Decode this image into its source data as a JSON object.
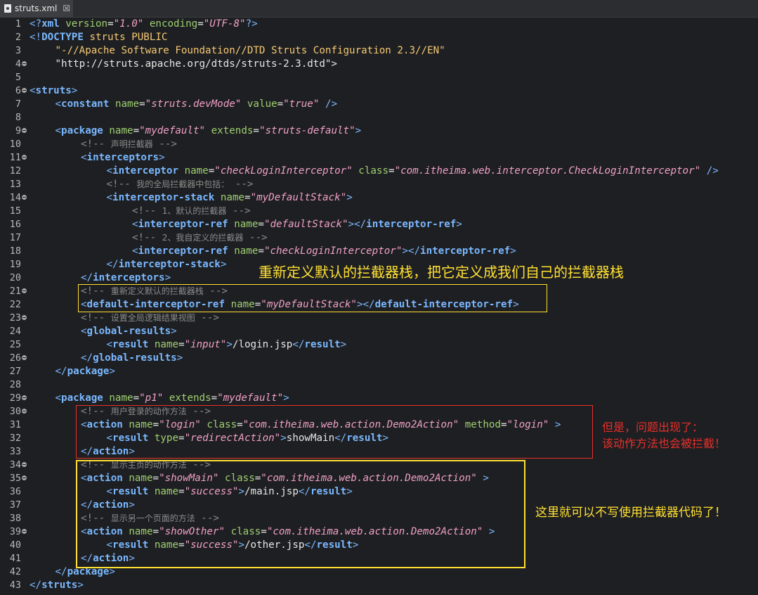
{
  "tab": {
    "filename": "struts.xml",
    "close_symbol": "☒"
  },
  "colors": {
    "tag": "#7ab8ff",
    "attr": "#9ed070",
    "value": "#f0a0c8",
    "comment": "#8c8c8c",
    "annotation_yellow": "#ffe033",
    "annotation_red": "#e8302b"
  },
  "lines": [
    {
      "n": "1",
      "fold": false,
      "indent": 0,
      "segs": [
        [
          "p",
          "<?"
        ],
        [
          "t",
          "xml"
        ],
        [
          "s",
          " "
        ],
        [
          "a",
          "version"
        ],
        [
          "s",
          "="
        ],
        [
          "v",
          "\"1.0\""
        ],
        [
          "s",
          " "
        ],
        [
          "a",
          "encoding"
        ],
        [
          "s",
          "="
        ],
        [
          "v",
          "\"UTF-8\""
        ],
        [
          "p",
          "?>"
        ]
      ]
    },
    {
      "n": "2",
      "fold": false,
      "indent": 0,
      "segs": [
        [
          "p",
          "<!"
        ],
        [
          "t",
          "DOCTYPE"
        ],
        [
          "s",
          " "
        ],
        [
          "dt",
          "struts PUBLIC"
        ]
      ]
    },
    {
      "n": "3",
      "fold": false,
      "indent": 1,
      "segs": [
        [
          "dt",
          "\"-//Apache Software Foundation//DTD Struts Configuration 2.3//EN\""
        ]
      ]
    },
    {
      "n": "4",
      "fold": true,
      "indent": 1,
      "segs": [
        [
          "s",
          "\"http://struts.apache.org/dtds/struts-2.3.dtd\">"
        ]
      ]
    },
    {
      "n": "5",
      "fold": false,
      "indent": 0,
      "segs": []
    },
    {
      "n": "6",
      "fold": true,
      "indent": 0,
      "segs": [
        [
          "p",
          "<"
        ],
        [
          "t",
          "struts"
        ],
        [
          "p",
          ">"
        ]
      ]
    },
    {
      "n": "7",
      "fold": false,
      "indent": 1,
      "segs": [
        [
          "p",
          "<"
        ],
        [
          "t",
          "constant"
        ],
        [
          "s",
          " "
        ],
        [
          "a",
          "name"
        ],
        [
          "s",
          "="
        ],
        [
          "v",
          "\"struts.devMode\""
        ],
        [
          "s",
          " "
        ],
        [
          "a",
          "value"
        ],
        [
          "s",
          "="
        ],
        [
          "v",
          "\"true\""
        ],
        [
          "s",
          " "
        ],
        [
          "p",
          "/>"
        ]
      ]
    },
    {
      "n": "8",
      "fold": false,
      "indent": 0,
      "segs": []
    },
    {
      "n": "9",
      "fold": true,
      "indent": 1,
      "segs": [
        [
          "p",
          "<"
        ],
        [
          "t",
          "package"
        ],
        [
          "s",
          " "
        ],
        [
          "a",
          "name"
        ],
        [
          "s",
          "="
        ],
        [
          "v",
          "\"mydefault\""
        ],
        [
          "s",
          " "
        ],
        [
          "a",
          "extends"
        ],
        [
          "s",
          "="
        ],
        [
          "v",
          "\"struts-default\""
        ],
        [
          "p",
          ">"
        ]
      ]
    },
    {
      "n": "10",
      "fold": false,
      "indent": 2,
      "segs": [
        [
          "c",
          "<!-- "
        ],
        [
          "cz",
          "声明拦截器"
        ],
        [
          "c",
          " -->"
        ]
      ]
    },
    {
      "n": "11",
      "fold": true,
      "indent": 2,
      "segs": [
        [
          "p",
          "<"
        ],
        [
          "t",
          "interceptors"
        ],
        [
          "p",
          ">"
        ]
      ]
    },
    {
      "n": "12",
      "fold": false,
      "indent": 3,
      "segs": [
        [
          "p",
          "<"
        ],
        [
          "t",
          "interceptor"
        ],
        [
          "s",
          " "
        ],
        [
          "a",
          "name"
        ],
        [
          "s",
          "="
        ],
        [
          "v",
          "\"checkLoginInterceptor\""
        ],
        [
          "s",
          " "
        ],
        [
          "a",
          "class"
        ],
        [
          "s",
          "="
        ],
        [
          "v",
          "\"com.itheima.web.interceptor.CheckLoginInterceptor\""
        ],
        [
          "s",
          " "
        ],
        [
          "p",
          "/>"
        ]
      ]
    },
    {
      "n": "13",
      "fold": false,
      "indent": 3,
      "segs": [
        [
          "c",
          "<!-- "
        ],
        [
          "cz",
          "我的全局拦截器中包括："
        ],
        [
          "c",
          " -->"
        ]
      ]
    },
    {
      "n": "14",
      "fold": true,
      "indent": 3,
      "segs": [
        [
          "p",
          "<"
        ],
        [
          "t",
          "interceptor-stack"
        ],
        [
          "s",
          " "
        ],
        [
          "a",
          "name"
        ],
        [
          "s",
          "="
        ],
        [
          "v",
          "\"myDefaultStack\""
        ],
        [
          "p",
          ">"
        ]
      ]
    },
    {
      "n": "15",
      "fold": false,
      "indent": 4,
      "segs": [
        [
          "c",
          "<!-- "
        ],
        [
          "cz",
          "1、默认的拦截器"
        ],
        [
          "c",
          " -->"
        ]
      ]
    },
    {
      "n": "16",
      "fold": false,
      "indent": 4,
      "segs": [
        [
          "p",
          "<"
        ],
        [
          "t",
          "interceptor-ref"
        ],
        [
          "s",
          " "
        ],
        [
          "a",
          "name"
        ],
        [
          "s",
          "="
        ],
        [
          "v",
          "\"defaultStack\""
        ],
        [
          "p",
          ">"
        ],
        [
          "p",
          "</"
        ],
        [
          "t",
          "interceptor-ref"
        ],
        [
          "p",
          ">"
        ]
      ]
    },
    {
      "n": "17",
      "fold": false,
      "indent": 4,
      "segs": [
        [
          "c",
          "<!-- "
        ],
        [
          "cz",
          "2、我自定义的拦截器"
        ],
        [
          "c",
          " -->"
        ]
      ]
    },
    {
      "n": "18",
      "fold": false,
      "indent": 4,
      "segs": [
        [
          "p",
          "<"
        ],
        [
          "t",
          "interceptor-ref"
        ],
        [
          "s",
          " "
        ],
        [
          "a",
          "name"
        ],
        [
          "s",
          "="
        ],
        [
          "v",
          "\"checkLoginInterceptor\""
        ],
        [
          "p",
          ">"
        ],
        [
          "p",
          "</"
        ],
        [
          "t",
          "interceptor-ref"
        ],
        [
          "p",
          ">"
        ]
      ]
    },
    {
      "n": "19",
      "fold": false,
      "indent": 3,
      "segs": [
        [
          "p",
          "</"
        ],
        [
          "t",
          "interceptor-stack"
        ],
        [
          "p",
          ">"
        ]
      ]
    },
    {
      "n": "20",
      "fold": false,
      "indent": 2,
      "segs": [
        [
          "p",
          "</"
        ],
        [
          "t",
          "interceptors"
        ],
        [
          "p",
          ">"
        ]
      ]
    },
    {
      "n": "21",
      "fold": true,
      "indent": 2,
      "segs": [
        [
          "c",
          "<!-- "
        ],
        [
          "cz",
          "重新定义默认的拦截器栈"
        ],
        [
          "c",
          " -->"
        ]
      ]
    },
    {
      "n": "22",
      "fold": false,
      "indent": 2,
      "segs": [
        [
          "p",
          "<"
        ],
        [
          "t",
          "default-interceptor-ref"
        ],
        [
          "s",
          " "
        ],
        [
          "a",
          "name"
        ],
        [
          "s",
          "="
        ],
        [
          "v",
          "\"myDefaultStack\""
        ],
        [
          "p",
          ">"
        ],
        [
          "p",
          "</"
        ],
        [
          "t",
          "default-interceptor-ref"
        ],
        [
          "p",
          ">"
        ]
      ]
    },
    {
      "n": "23",
      "fold": true,
      "indent": 2,
      "segs": [
        [
          "c",
          "<!-- "
        ],
        [
          "cz",
          "设置全局逻辑结果视图"
        ],
        [
          "c",
          " -->"
        ]
      ]
    },
    {
      "n": "24",
      "fold": false,
      "indent": 2,
      "segs": [
        [
          "p",
          "<"
        ],
        [
          "t",
          "global-results"
        ],
        [
          "p",
          ">"
        ]
      ]
    },
    {
      "n": "25",
      "fold": false,
      "indent": 3,
      "segs": [
        [
          "p",
          "<"
        ],
        [
          "t",
          "result"
        ],
        [
          "s",
          " "
        ],
        [
          "a",
          "name"
        ],
        [
          "s",
          "="
        ],
        [
          "v",
          "\"input\""
        ],
        [
          "p",
          ">"
        ],
        [
          "s",
          "/login.jsp"
        ],
        [
          "p",
          "</"
        ],
        [
          "t",
          "result"
        ],
        [
          "p",
          ">"
        ]
      ]
    },
    {
      "n": "26",
      "fold": true,
      "indent": 2,
      "segs": [
        [
          "p",
          "</"
        ],
        [
          "t",
          "global-results"
        ],
        [
          "p",
          ">"
        ]
      ]
    },
    {
      "n": "27",
      "fold": false,
      "indent": 1,
      "segs": [
        [
          "p",
          "</"
        ],
        [
          "t",
          "package"
        ],
        [
          "p",
          ">"
        ]
      ]
    },
    {
      "n": "28",
      "fold": false,
      "indent": 0,
      "segs": []
    },
    {
      "n": "29",
      "fold": true,
      "indent": 1,
      "segs": [
        [
          "p",
          "<"
        ],
        [
          "t",
          "package"
        ],
        [
          "s",
          " "
        ],
        [
          "a",
          "name"
        ],
        [
          "s",
          "="
        ],
        [
          "v",
          "\"p1\""
        ],
        [
          "s",
          " "
        ],
        [
          "a",
          "extends"
        ],
        [
          "s",
          "="
        ],
        [
          "v",
          "\"mydefault\""
        ],
        [
          "p",
          ">"
        ]
      ]
    },
    {
      "n": "30",
      "fold": true,
      "indent": 2,
      "segs": [
        [
          "c",
          "<!-- "
        ],
        [
          "cz",
          "用户登录的动作方法"
        ],
        [
          "c",
          " -->"
        ]
      ]
    },
    {
      "n": "31",
      "fold": false,
      "indent": 2,
      "segs": [
        [
          "p",
          "<"
        ],
        [
          "t",
          "action"
        ],
        [
          "s",
          " "
        ],
        [
          "a",
          "name"
        ],
        [
          "s",
          "="
        ],
        [
          "v",
          "\"login\""
        ],
        [
          "s",
          " "
        ],
        [
          "a",
          "class"
        ],
        [
          "s",
          "="
        ],
        [
          "v",
          "\"com.itheima.web.action.Demo2Action\""
        ],
        [
          "s",
          " "
        ],
        [
          "a",
          "method"
        ],
        [
          "s",
          "="
        ],
        [
          "v",
          "\"login\""
        ],
        [
          "s",
          " "
        ],
        [
          "p",
          ">"
        ]
      ]
    },
    {
      "n": "32",
      "fold": false,
      "indent": 3,
      "segs": [
        [
          "p",
          "<"
        ],
        [
          "t",
          "result"
        ],
        [
          "s",
          " "
        ],
        [
          "a",
          "type"
        ],
        [
          "s",
          "="
        ],
        [
          "v",
          "\"redirectAction\""
        ],
        [
          "p",
          ">"
        ],
        [
          "s",
          "showMain"
        ],
        [
          "p",
          "</"
        ],
        [
          "t",
          "result"
        ],
        [
          "p",
          ">"
        ]
      ]
    },
    {
      "n": "33",
      "fold": false,
      "indent": 2,
      "segs": [
        [
          "p",
          "</"
        ],
        [
          "t",
          "action"
        ],
        [
          "p",
          ">"
        ]
      ]
    },
    {
      "n": "34",
      "fold": true,
      "indent": 2,
      "segs": [
        [
          "c",
          "<!-- "
        ],
        [
          "cz",
          "显示主页的动作方法"
        ],
        [
          "c",
          " -->"
        ]
      ]
    },
    {
      "n": "35",
      "fold": true,
      "indent": 2,
      "segs": [
        [
          "p",
          "<"
        ],
        [
          "t",
          "action"
        ],
        [
          "s",
          " "
        ],
        [
          "a",
          "name"
        ],
        [
          "s",
          "="
        ],
        [
          "v",
          "\"showMain\""
        ],
        [
          "s",
          " "
        ],
        [
          "a",
          "class"
        ],
        [
          "s",
          "="
        ],
        [
          "v",
          "\"com.itheima.web.action.Demo2Action\""
        ],
        [
          "s",
          " "
        ],
        [
          "p",
          ">"
        ]
      ]
    },
    {
      "n": "36",
      "fold": false,
      "indent": 3,
      "segs": [
        [
          "p",
          "<"
        ],
        [
          "t",
          "result"
        ],
        [
          "s",
          " "
        ],
        [
          "a",
          "name"
        ],
        [
          "s",
          "="
        ],
        [
          "v",
          "\"success\""
        ],
        [
          "p",
          ">"
        ],
        [
          "s",
          "/main.jsp"
        ],
        [
          "p",
          "</"
        ],
        [
          "t",
          "result"
        ],
        [
          "p",
          ">"
        ]
      ]
    },
    {
      "n": "37",
      "fold": false,
      "indent": 2,
      "segs": [
        [
          "p",
          "</"
        ],
        [
          "t",
          "action"
        ],
        [
          "p",
          ">"
        ]
      ]
    },
    {
      "n": "38",
      "fold": false,
      "indent": 2,
      "segs": [
        [
          "c",
          "<!-- "
        ],
        [
          "cz",
          "显示另一个页面的方法"
        ],
        [
          "c",
          " -->"
        ]
      ]
    },
    {
      "n": "39",
      "fold": true,
      "indent": 2,
      "segs": [
        [
          "p",
          "<"
        ],
        [
          "t",
          "action"
        ],
        [
          "s",
          " "
        ],
        [
          "a",
          "name"
        ],
        [
          "s",
          "="
        ],
        [
          "v",
          "\"showOther\""
        ],
        [
          "s",
          " "
        ],
        [
          "a",
          "class"
        ],
        [
          "s",
          "="
        ],
        [
          "v",
          "\"com.itheima.web.action.Demo2Action\""
        ],
        [
          "s",
          " "
        ],
        [
          "p",
          ">"
        ]
      ]
    },
    {
      "n": "40",
      "fold": false,
      "indent": 3,
      "segs": [
        [
          "p",
          "<"
        ],
        [
          "t",
          "result"
        ],
        [
          "s",
          " "
        ],
        [
          "a",
          "name"
        ],
        [
          "s",
          "="
        ],
        [
          "v",
          "\"success\""
        ],
        [
          "p",
          ">"
        ],
        [
          "s",
          "/other.jsp"
        ],
        [
          "p",
          "</"
        ],
        [
          "t",
          "result"
        ],
        [
          "p",
          ">"
        ]
      ]
    },
    {
      "n": "41",
      "fold": false,
      "indent": 2,
      "segs": [
        [
          "p",
          "</"
        ],
        [
          "t",
          "action"
        ],
        [
          "p",
          ">"
        ]
      ]
    },
    {
      "n": "42",
      "fold": false,
      "indent": 1,
      "segs": [
        [
          "p",
          "</"
        ],
        [
          "t",
          "package"
        ],
        [
          "p",
          ">"
        ]
      ]
    },
    {
      "n": "43",
      "fold": false,
      "indent": 0,
      "segs": [
        [
          "p",
          "</"
        ],
        [
          "t",
          "struts"
        ],
        [
          "p",
          ">"
        ]
      ]
    }
  ],
  "annotations": {
    "redefine": "重新定义默认的拦截器栈，把它定义成我们自己的拦截器栈",
    "problem_line1": "但是，问题出现了：",
    "problem_line2": "该动作方法也会被拦截！",
    "no_code": "这里就可以不写使用拦截器代码了！"
  }
}
